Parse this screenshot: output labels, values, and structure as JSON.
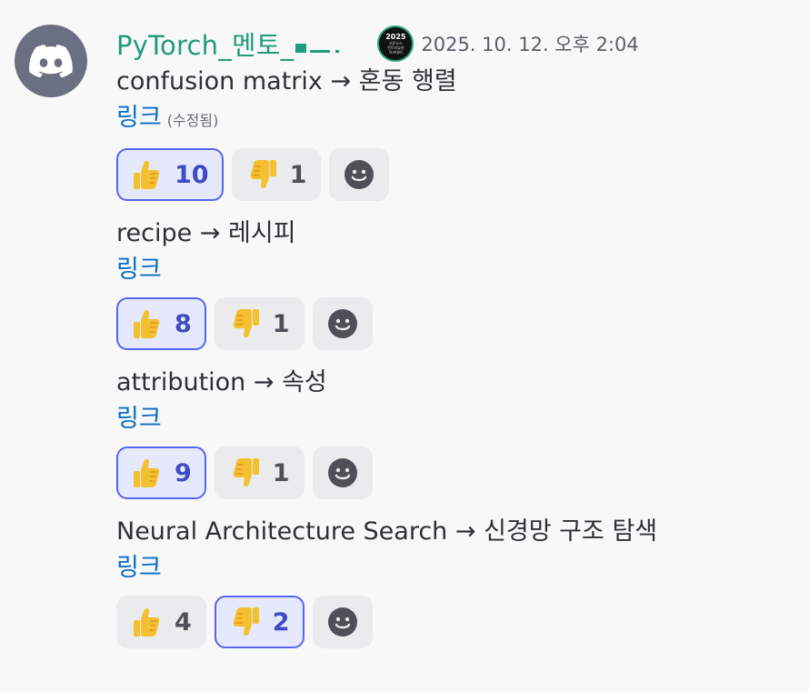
{
  "author": {
    "name": "PyTorch_멘토_",
    "timestamp": "2025. 10. 12. 오후 2:04",
    "badge": {
      "year": "2025",
      "line1": "오픈소스",
      "line2": "컨트리뷰션",
      "line3": "아카데미"
    }
  },
  "colors": {
    "username": "#1f9d7a",
    "link": "#0b6dc7",
    "active_border": "#5865f2",
    "avatar_bg": "#6b6f82"
  },
  "entries": [
    {
      "term": "confusion matrix → 혼동 행렬",
      "link": "링크",
      "edited": "(수정됨)",
      "thumbs_up": "10",
      "thumbs_down": "1",
      "up_active": true,
      "down_active": false
    },
    {
      "term": "recipe → 레시피",
      "link": "링크",
      "edited": "",
      "thumbs_up": "8",
      "thumbs_down": "1",
      "up_active": true,
      "down_active": false
    },
    {
      "term": "attribution → 속성",
      "link": "링크",
      "edited": "",
      "thumbs_up": "9",
      "thumbs_down": "1",
      "up_active": true,
      "down_active": false
    },
    {
      "term": "Neural Architecture Search → 신경망 구조 탐색",
      "link": "링크",
      "edited": "",
      "thumbs_up": "4",
      "thumbs_down": "2",
      "up_active": false,
      "down_active": true
    }
  ],
  "icons": {
    "avatar": "discord-logo-icon",
    "thumbs_up": "thumbs-up-icon",
    "thumbs_down": "thumbs-down-icon",
    "add_reaction": "smiley-add-reaction-icon"
  }
}
